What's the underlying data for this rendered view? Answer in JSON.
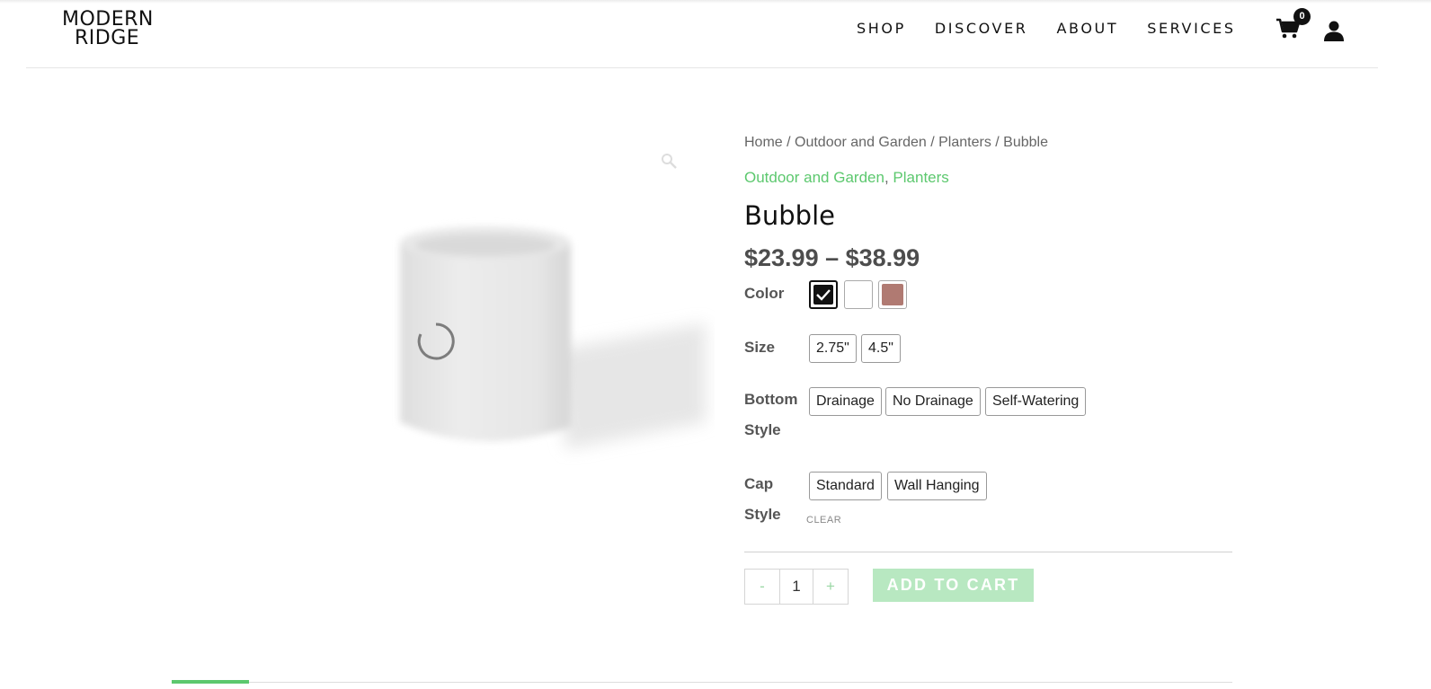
{
  "header": {
    "logo_line1": "MODERN",
    "logo_line2": "RIDGE",
    "nav": [
      "SHOP",
      "DISCOVER",
      "ABOUT",
      "SERVICES"
    ],
    "cart_count": "0",
    "cart_icon": "shopping-cart-icon",
    "account_icon": "user-icon"
  },
  "breadcrumb": {
    "text": "Home / Outdoor and Garden / Planters / Bubble"
  },
  "categories": {
    "cat1": "Outdoor and Garden",
    "separator": ",",
    "cat2": "Planters"
  },
  "product": {
    "title": "Bubble",
    "price": "$23.99 – $38.99",
    "accent_color": "#5cc86e"
  },
  "attributes": {
    "color_label": "Color",
    "color_swatches": [
      "#111111",
      "#ffffff",
      "#b07a72"
    ],
    "color_selected": 0,
    "size_label": "Size",
    "size_options": [
      "2.75\"",
      "4.5\""
    ],
    "bottom_label_1": "Bottom",
    "bottom_label_2": "Style",
    "bottom_options": [
      "Drainage",
      "No Drainage",
      "Self-Watering"
    ],
    "cap_label_1": "Cap",
    "cap_label_2": "Style",
    "cap_options": [
      "Standard",
      "Wall Hanging"
    ],
    "clear_label": "CLEAR"
  },
  "cart": {
    "minus": "-",
    "quantity": "1",
    "plus": "+",
    "add_to_cart": "ADD TO CART"
  }
}
